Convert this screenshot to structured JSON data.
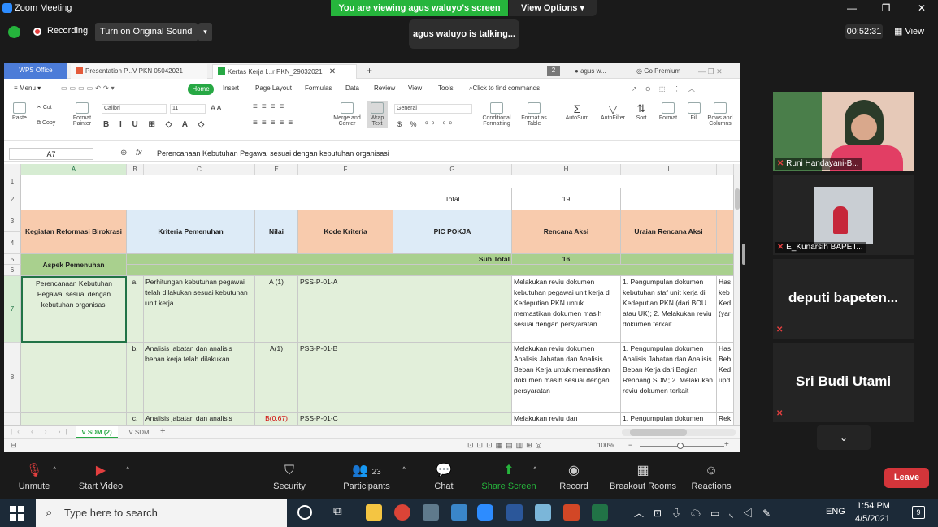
{
  "zoom": {
    "window_title": "Zoom Meeting",
    "viewing_banner": "You are viewing agus waluyo's screen",
    "view_options": "View Options",
    "view_options_chevron": "▾",
    "recording_label": "Recording",
    "original_sound": "Turn on Original Sound",
    "original_sound_caret": "▾",
    "talking_indicator": "agus waluyo is talking...",
    "timer": "00:52:31",
    "view_label": "View",
    "win_minimize": "—",
    "win_restore": "❐",
    "win_close": "✕"
  },
  "wps": {
    "tabs": [
      {
        "label": "WPS Office"
      },
      {
        "label": "Presentation P...V PKN 05042021"
      },
      {
        "label": "Kertas Kerja I...r PKN_29032021"
      }
    ],
    "add_tab": "+",
    "user": "agus w...",
    "premium": "Go Premium",
    "tab_count": "2",
    "menu_items": [
      "Menu",
      "Home",
      "Insert",
      "Page Layout",
      "Formulas",
      "Data",
      "Review",
      "View",
      "Tools"
    ],
    "find_commands": "Click to find commands",
    "ribbon": {
      "paste": "Paste",
      "cut": "Cut",
      "copy": "Copy",
      "format_painter": "Format Painter",
      "font": "Calibri",
      "font_size": "11",
      "merge_center": "Merge and Center",
      "wrap_text": "Wrap Text",
      "number_format": "General",
      "conditional_formatting": "Conditional Formatting",
      "format_as_table": "Format as Table",
      "autosum": "AutoSum",
      "autofilter": "AutoFilter",
      "sort": "Sort",
      "format": "Format",
      "fill": "Fill",
      "rows_columns": "Rows and Columns"
    },
    "name_box": "A7",
    "fx": "fx",
    "formula": "Perencanaan Kebutuhan Pegawai sesuai dengan kebutuhan organisasi",
    "columns": [
      "A",
      "B",
      "C",
      "E",
      "F",
      "G",
      "H",
      "I"
    ],
    "row_numbers": [
      "1",
      "2",
      "3",
      "4",
      "5",
      "6",
      "7",
      "8"
    ],
    "cells": {
      "total_label": "Total",
      "total_value": "19",
      "h_kegiatan": "Kegiatan Reformasi Birokrasi",
      "h_kriteria": "Kriteria Pemenuhan",
      "h_nilai": "Nilai",
      "h_kode": "Kode Kriteria",
      "h_pic": "PIC POKJA",
      "h_rencana": "Rencana Aksi",
      "h_uraian": "Uraian Rencana Aksi",
      "aspek": "Aspek Pemenuhan",
      "subtotal_label": "Sub Total",
      "subtotal_value": "16",
      "a7": "Perencanaan Kebutuhan Pegawai sesuai dengan kebutuhan organisasi",
      "b7": "a.",
      "c7": "Perhitungan kebutuhan pegawai telah dilakukan sesuai kebutuhan unit kerja",
      "e7": "A (1)",
      "f7": "PSS-P-01-A",
      "h7": "Melakukan reviu dokumen kebutuhan pegawai  unit kerja di Kedeputian PKN untuk memastikan dokumen masih sesuai dengan persyaratan",
      "i7": "1. Pengumpulan dokumen  kebutuhan staf unit kerja di Kedeputian PKN (dari BOU atau UK); 2. Melakukan reviu dokumen terkait",
      "j7": "Has keb Ked (yar",
      "b8": "b.",
      "c8": "Analisis jabatan dan analisis beban kerja telah dilakukan",
      "e8": "A(1)",
      "f8": "PSS-P-01-B",
      "h8": "Melakukan reviu dokumen Analisis Jabatan dan Analisis Beban Kerja untuk memastikan dokumen masih sesuai dengan persyaratan",
      "i8": "1. Pengumpulan dokumen Analisis Jabatan dan Analisis Beban Kerja dari Bagian Renbang SDM; 2. Melakukan reviu dokumen terkait",
      "j8": "Has Beb Ked upd",
      "b9": "c.",
      "c9": "Analisis jabatan dan analisis",
      "e9": "B(0,67)",
      "f9": "PSS-P-01-C",
      "h9": "Melakukan reviu dan",
      "i9": "1. Pengumpulan dokumen",
      "j9": "Rek"
    },
    "sheet_tabs": [
      "V SDM (2)",
      "V SDM"
    ],
    "sheet_add": "+",
    "zoom_pct": "100%",
    "zoom_minus": "−",
    "zoom_plus": "+"
  },
  "participants": [
    {
      "name": "Runi Handayani-B..."
    },
    {
      "name": "E_Kunarsih BAPET..."
    },
    {
      "name": "deputi  bapeten..."
    },
    {
      "name": "Sri Budi Utami"
    }
  ],
  "mic_off_glyph": "✕",
  "scroll_down": "⌄",
  "toolbar": {
    "unmute": "Unmute",
    "start_video": "Start Video",
    "security": "Security",
    "participants": "Participants",
    "participants_count": "23",
    "chat": "Chat",
    "share_screen": "Share Screen",
    "record": "Record",
    "breakout_rooms": "Breakout Rooms",
    "reactions": "Reactions",
    "leave": "Leave",
    "caret": "^"
  },
  "taskbar": {
    "search_placeholder": "Type here to search",
    "language": "ENG",
    "time": "1:54 PM",
    "date": "4/5/2021",
    "notifications": "9"
  },
  "colors": {
    "zoom_green": "#26b53c",
    "leave_red": "#d3353a",
    "header_orange": "#f8cbad",
    "header_blue": "#ddebf7",
    "aspek_green": "#a9d08e",
    "row_lightgreen": "#e2efda"
  }
}
